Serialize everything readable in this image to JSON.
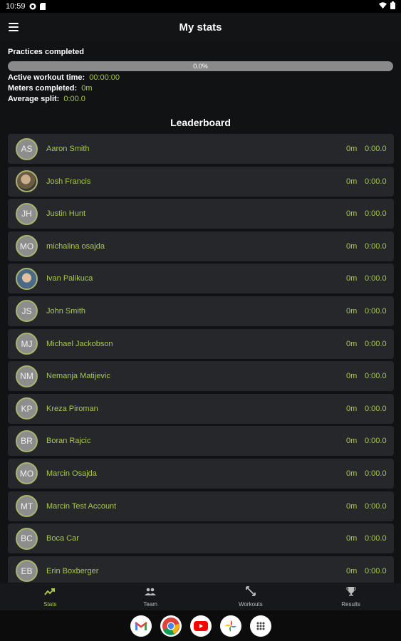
{
  "status_bar": {
    "time": "10:59"
  },
  "app_bar": {
    "title": "My stats"
  },
  "stats": {
    "practices_label": "Practices completed",
    "progress_value": 0.0,
    "progress_text": "0.0%",
    "active_time_label": "Active workout time:",
    "active_time_value": "00:00:00",
    "meters_label": "Meters completed:",
    "meters_value": "0m",
    "avg_split_label": "Average split:",
    "avg_split_value": "0:00.0"
  },
  "leaderboard": {
    "title": "Leaderboard",
    "rows": [
      {
        "initials": "AS",
        "name": "Aaron Smith",
        "meters": "0m",
        "split": "0:00.0",
        "photo": ""
      },
      {
        "initials": "",
        "name": "Josh Francis",
        "meters": "0m",
        "split": "0:00.0",
        "photo": "photo1"
      },
      {
        "initials": "JH",
        "name": "Justin Hunt",
        "meters": "0m",
        "split": "0:00.0",
        "photo": ""
      },
      {
        "initials": "MO",
        "name": "michalina osajda",
        "meters": "0m",
        "split": "0:00.0",
        "photo": ""
      },
      {
        "initials": "",
        "name": "Ivan Palikuca",
        "meters": "0m",
        "split": "0:00.0",
        "photo": "photo2"
      },
      {
        "initials": "JS",
        "name": "John Smith",
        "meters": "0m",
        "split": "0:00.0",
        "photo": ""
      },
      {
        "initials": "MJ",
        "name": "Michael Jackobson",
        "meters": "0m",
        "split": "0:00.0",
        "photo": ""
      },
      {
        "initials": "NM",
        "name": "Nemanja Matijevic",
        "meters": "0m",
        "split": "0:00.0",
        "photo": ""
      },
      {
        "initials": "KP",
        "name": "Kreza Piroman",
        "meters": "0m",
        "split": "0:00.0",
        "photo": ""
      },
      {
        "initials": "BR",
        "name": "Boran Rajcic",
        "meters": "0m",
        "split": "0:00.0",
        "photo": ""
      },
      {
        "initials": "MO",
        "name": "Marcin Osajda",
        "meters": "0m",
        "split": "0:00.0",
        "photo": ""
      },
      {
        "initials": "MT",
        "name": "Marcin Test Account",
        "meters": "0m",
        "split": "0:00.0",
        "photo": ""
      },
      {
        "initials": "BC",
        "name": "Boca Car",
        "meters": "0m",
        "split": "0:00.0",
        "photo": ""
      },
      {
        "initials": "EB",
        "name": "Erin Boxberger",
        "meters": "0m",
        "split": "0:00.0",
        "photo": ""
      }
    ]
  },
  "bottom_nav": {
    "items": [
      {
        "label": "Stats",
        "icon": "trending-up-icon",
        "active": true
      },
      {
        "label": "Team",
        "icon": "people-icon",
        "active": false
      },
      {
        "label": "Workouts",
        "icon": "expand-arrows-icon",
        "active": false
      },
      {
        "label": "Results",
        "icon": "trophy-icon",
        "active": false
      }
    ]
  },
  "dock": {
    "apps": [
      "gmail-icon",
      "chrome-icon",
      "youtube-icon",
      "photos-icon",
      "app-drawer-icon"
    ]
  },
  "colors": {
    "accent": "#a8c84a",
    "row_bg": "#26272b",
    "bg": "#111214"
  }
}
